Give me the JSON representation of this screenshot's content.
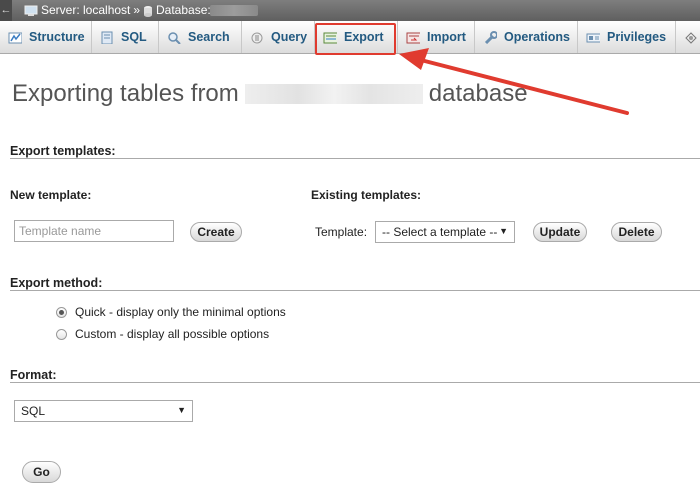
{
  "breadcrumb": {
    "back_glyph": "←",
    "server_label": "Server: localhost",
    "separator": "»",
    "database_label": "Database:"
  },
  "tabs": [
    {
      "label": "Structure",
      "icon": "structure-icon"
    },
    {
      "label": "SQL",
      "icon": "sql-icon"
    },
    {
      "label": "Search",
      "icon": "search-icon"
    },
    {
      "label": "Query",
      "icon": "query-icon"
    },
    {
      "label": "Export",
      "icon": "export-icon",
      "highlighted": true
    },
    {
      "label": "Import",
      "icon": "import-icon"
    },
    {
      "label": "Operations",
      "icon": "operations-icon"
    },
    {
      "label": "Privileges",
      "icon": "privileges-icon"
    }
  ],
  "page": {
    "title_prefix": "Exporting tables from",
    "title_suffix": "database"
  },
  "export_templates": {
    "heading": "Export templates:",
    "new_template_label": "New template:",
    "template_name_placeholder": "Template name",
    "create_button": "Create",
    "existing_templates_label": "Existing templates:",
    "template_label": "Template:",
    "template_select_value": "-- Select a template --",
    "update_button": "Update",
    "delete_button": "Delete"
  },
  "export_method": {
    "heading": "Export method:",
    "options": [
      {
        "label": "Quick - display only the minimal options",
        "selected": true
      },
      {
        "label": "Custom - display all possible options",
        "selected": false
      }
    ]
  },
  "format": {
    "heading": "Format:",
    "selected": "SQL"
  },
  "go_button": "Go",
  "colors": {
    "highlight": "#e03b2f",
    "tab_text": "#235a81",
    "breadcrumb_bg": "#6e6e6e"
  }
}
